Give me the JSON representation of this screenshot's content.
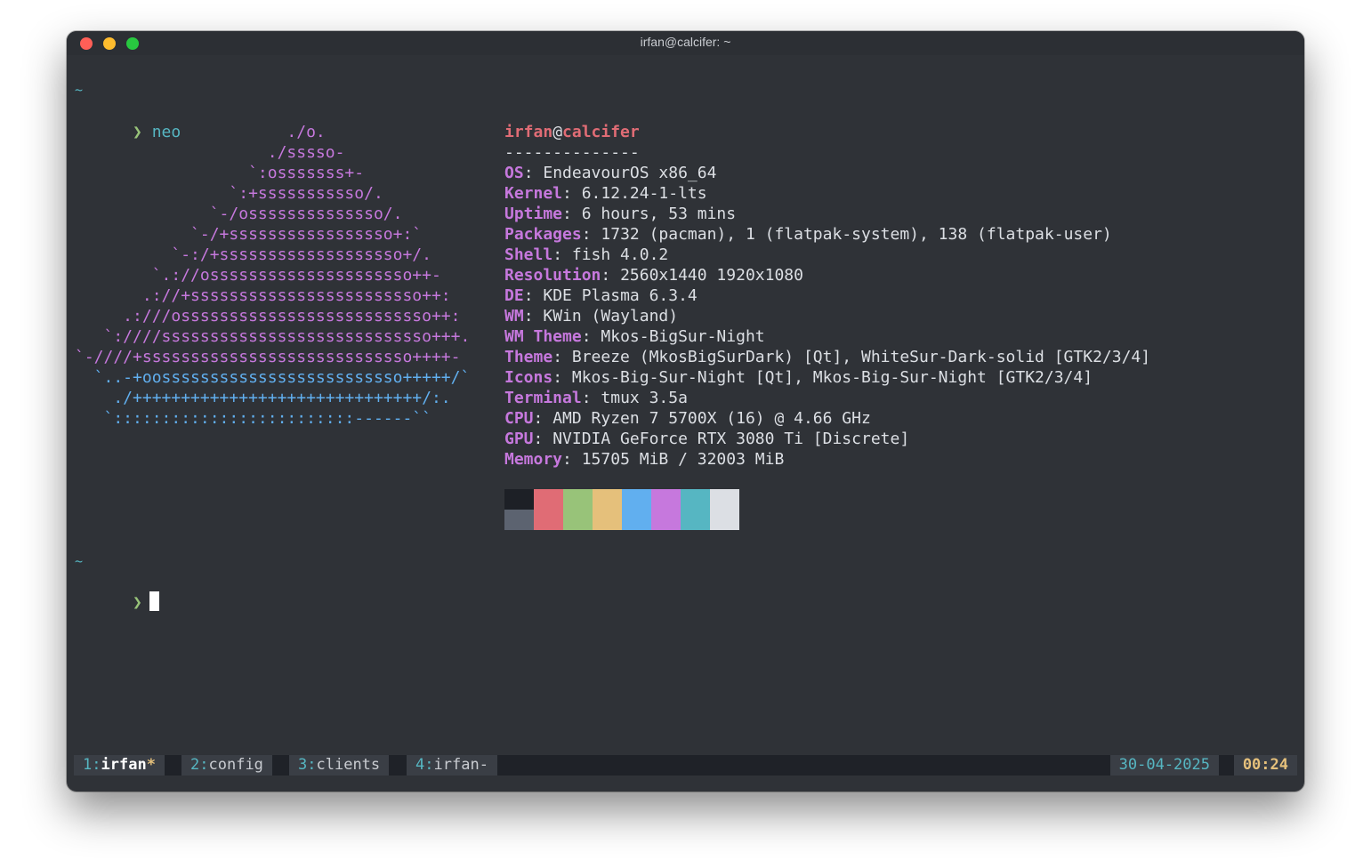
{
  "window": {
    "title": "irfan@calcifer: ~"
  },
  "session": {
    "first_cwd": "~",
    "prompt_symbol": "❯",
    "command": "neo",
    "second_cwd": "~"
  },
  "ascii_art": [
    {
      "text": "                      ./o.",
      "color": "pink"
    },
    {
      "text": "                    ./sssso-",
      "color": "pink"
    },
    {
      "text": "                  `:osssssss+-",
      "color": "pink"
    },
    {
      "text": "                `:+sssssssssso/.",
      "color": "pink"
    },
    {
      "text": "              `-/ossssssssssssso/.",
      "color": "pink"
    },
    {
      "text": "            `-/+sssssssssssssssso+:`",
      "color": "pink"
    },
    {
      "text": "          `-:/+sssssssssssssssssso+/.",
      "color": "pink"
    },
    {
      "text": "        `.://osssssssssssssssssssso++-",
      "color": "pink"
    },
    {
      "text": "       .://+ssssssssssssssssssssssso++:",
      "color": "pink"
    },
    {
      "text": "     .:///ossssssssssssssssssssssssso++:",
      "color": "pink"
    },
    {
      "text": "   `:////ssssssssssssssssssssssssssso+++.",
      "color": "pink"
    },
    {
      "text": "`-////+ssssssssssssssssssssssssssso++++-",
      "color": "pink"
    },
    {
      "text": "  `..-+oosssssssssssssssssssssssso+++++/`",
      "color": "blue"
    },
    {
      "text": "    ./++++++++++++++++++++++++++++++/:.",
      "color": "blue"
    },
    {
      "text": "   `:::::::::::::::::::::::::------``",
      "color": "blue"
    }
  ],
  "sysinfo": {
    "user": "irfan",
    "at": "@",
    "host": "calcifer",
    "separator": "--------------",
    "fields": [
      {
        "label": "OS",
        "value": "EndeavourOS x86_64"
      },
      {
        "label": "Kernel",
        "value": "6.12.24-1-lts"
      },
      {
        "label": "Uptime",
        "value": "6 hours, 53 mins"
      },
      {
        "label": "Packages",
        "value": "1732 (pacman), 1 (flatpak-system), 138 (flatpak-user)"
      },
      {
        "label": "Shell",
        "value": "fish 4.0.2"
      },
      {
        "label": "Resolution",
        "value": "2560x1440 1920x1080"
      },
      {
        "label": "DE",
        "value": "KDE Plasma 6.3.4"
      },
      {
        "label": "WM",
        "value": "KWin (Wayland)"
      },
      {
        "label": "WM Theme",
        "value": "Mkos-BigSur-Night"
      },
      {
        "label": "Theme",
        "value": "Breeze (MkosBigSurDark) [Qt], WhiteSur-Dark-solid [GTK2/3/4]"
      },
      {
        "label": "Icons",
        "value": "Mkos-Big-Sur-Night [Qt], Mkos-Big-Sur-Night [GTK2/3/4]"
      },
      {
        "label": "Terminal",
        "value": "tmux 3.5a"
      },
      {
        "label": "CPU",
        "value": "AMD Ryzen 7 5700X (16) @ 4.66 GHz"
      },
      {
        "label": "GPU",
        "value": "NVIDIA GeForce RTX 3080 Ti [Discrete]"
      },
      {
        "label": "Memory",
        "value": "15705 MiB / 32003 MiB"
      }
    ],
    "palette_top": [
      "#1d2026",
      "#e06c75",
      "#98c379",
      "#e5c07b",
      "#61afef",
      "#c678dd",
      "#56b6c2",
      "#dcdfe4"
    ],
    "palette_bottom": [
      "#5c6370",
      "#e06c75",
      "#98c379",
      "#e5c07b",
      "#61afef",
      "#c678dd",
      "#56b6c2",
      "#dcdfe4"
    ]
  },
  "tmux": {
    "windows": [
      {
        "num": "1",
        "name": "irfan",
        "flag": "*",
        "active": true
      },
      {
        "num": "2",
        "name": "config",
        "flag": "",
        "active": false
      },
      {
        "num": "3",
        "name": "clients",
        "flag": "",
        "active": false
      },
      {
        "num": "4",
        "name": "irfan",
        "flag": "-",
        "active": false
      }
    ],
    "date": "30-04-2025",
    "time": "00:24"
  }
}
